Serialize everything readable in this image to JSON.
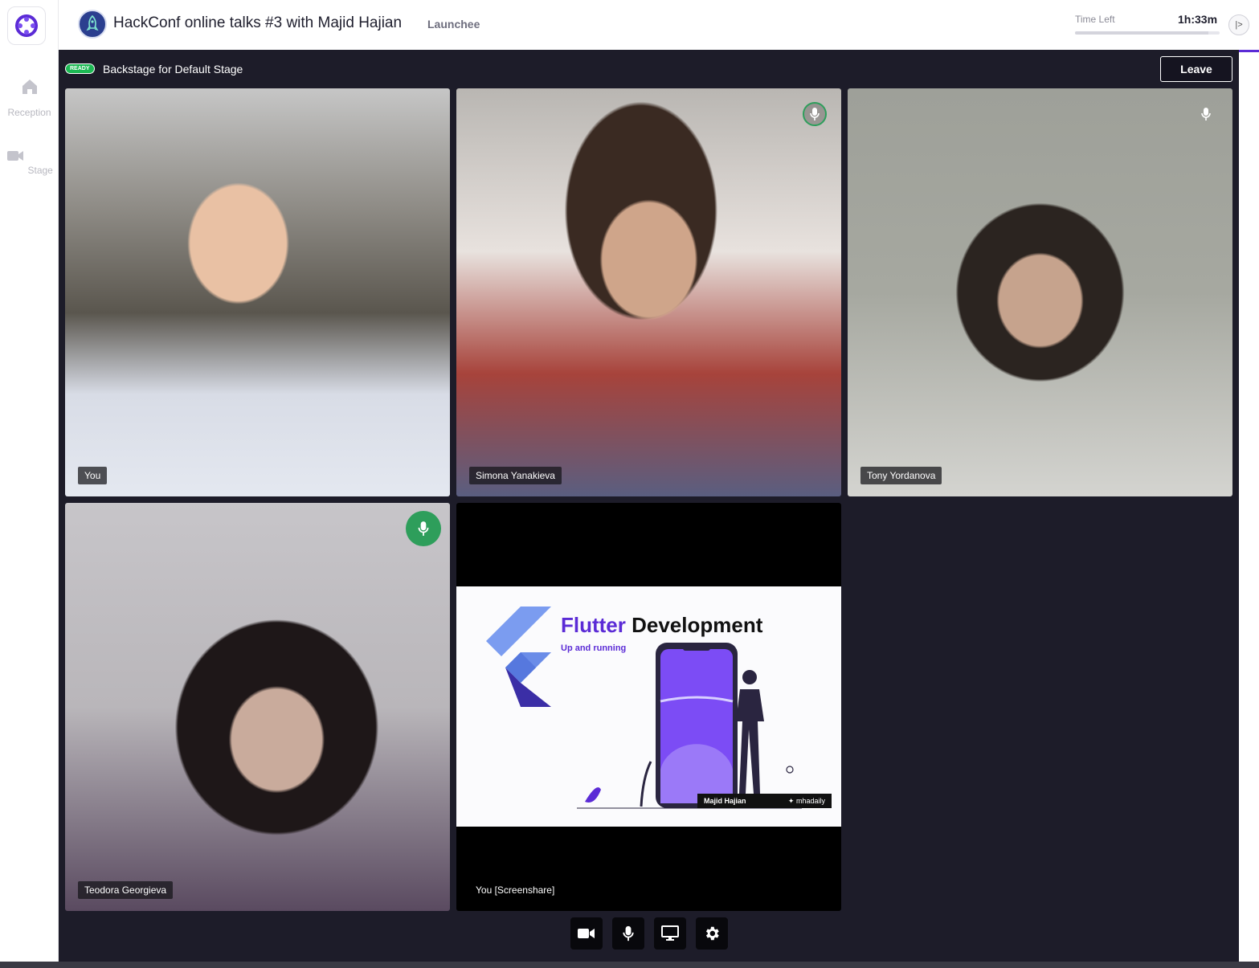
{
  "header": {
    "event_title": "HackConf online talks #3 with Majid Hajian",
    "organizer": "Launchee",
    "time_left_label": "Time Left",
    "time_left_value": "1h:33m",
    "time_progress": 0.92
  },
  "sidebar": {
    "items": [
      {
        "label": "Reception",
        "icon": "home-icon"
      },
      {
        "label": "Stage",
        "icon": "video-camera-icon"
      }
    ]
  },
  "stage": {
    "status_badge": "READY",
    "title": "Backstage for Default Stage",
    "leave_label": "Leave"
  },
  "participants": [
    {
      "name": "You",
      "mic": "none"
    },
    {
      "name": "Simona Yanakieva",
      "mic": "speaking-outline"
    },
    {
      "name": "Tony Yordanova",
      "mic": "muted-idle"
    },
    {
      "name": "Teodora Georgieva",
      "mic": "speaking-filled"
    },
    {
      "name": "You [Screenshare]",
      "mic": "none"
    }
  ],
  "slide": {
    "title_accent": "Flutter",
    "title_rest": " Development",
    "subtitle": "Up and running",
    "author": "Majid Hajian",
    "handle": "mhadaily"
  },
  "controls": [
    {
      "name": "camera-button",
      "icon": "camera-icon"
    },
    {
      "name": "microphone-button",
      "icon": "microphone-icon"
    },
    {
      "name": "screenshare-button",
      "icon": "monitor-icon"
    },
    {
      "name": "settings-button",
      "icon": "gear-icon"
    }
  ],
  "colors": {
    "brand": "#5b2bd6",
    "stage_bg": "#1d1c29",
    "ready": "#1db954",
    "speaking": "#2e9e5b"
  }
}
